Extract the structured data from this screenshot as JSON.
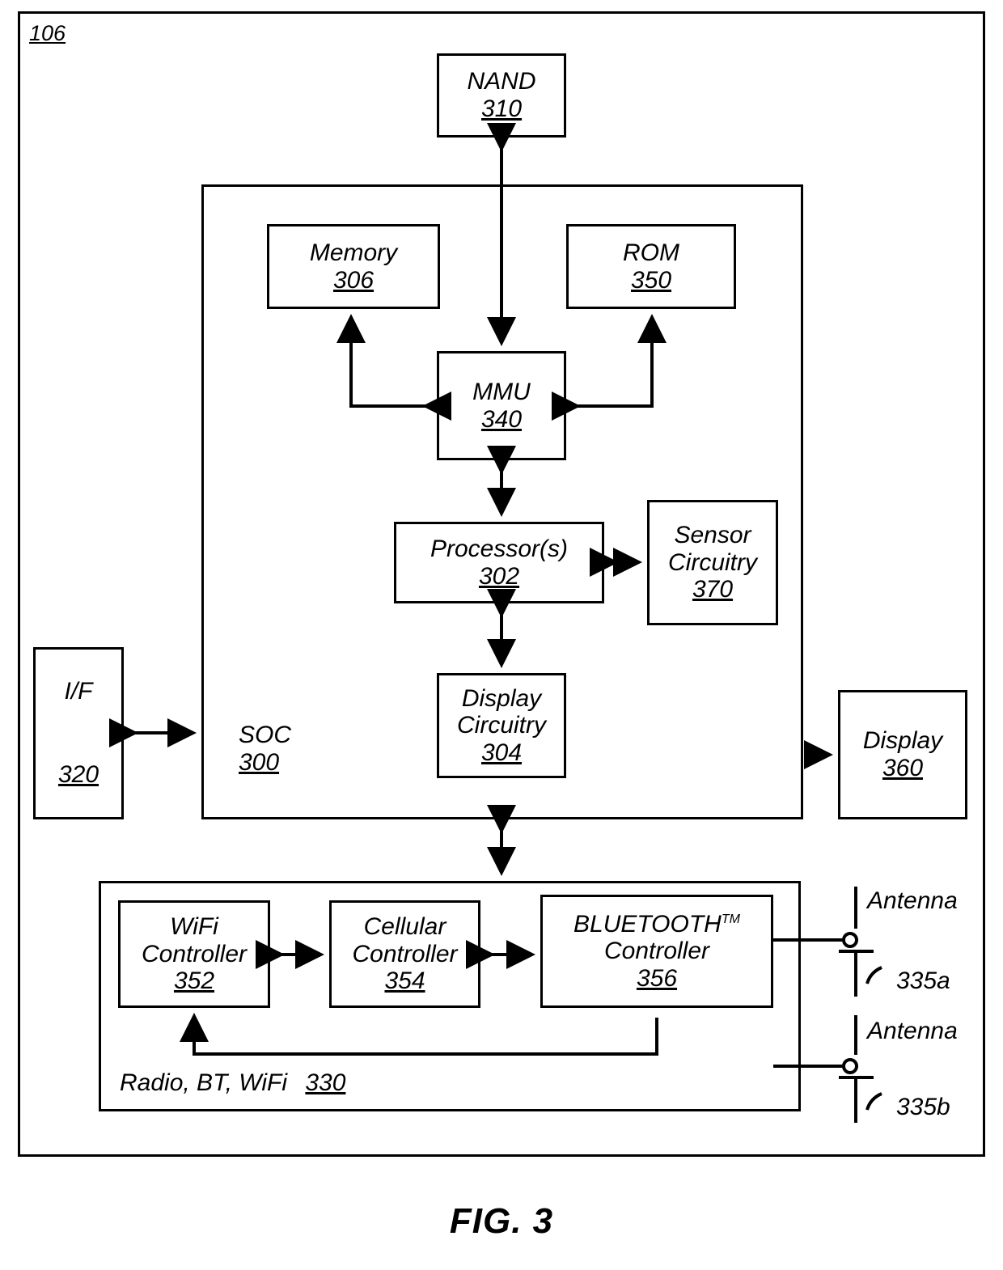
{
  "figure": {
    "caption": "FIG. 3",
    "outer_ref": "106"
  },
  "blocks": {
    "nand": {
      "label": "NAND",
      "num": "310"
    },
    "memory": {
      "label": "Memory",
      "num": "306"
    },
    "rom": {
      "label": "ROM",
      "num": "350"
    },
    "mmu": {
      "label": "MMU",
      "num": "340"
    },
    "processor": {
      "label": "Processor(s)",
      "num": "302"
    },
    "sensor": {
      "label_line1": "Sensor",
      "label_line2": "Circuitry",
      "num": "370"
    },
    "display_circuitry": {
      "label_line1": "Display",
      "label_line2": "Circuitry",
      "num": "304"
    },
    "display": {
      "label": "Display",
      "num": "360"
    },
    "interface": {
      "label": "I/F",
      "num": "320"
    },
    "soc": {
      "label": "SOC",
      "num": "300"
    },
    "radio": {
      "label": "Radio, BT, WiFi",
      "num": "330"
    },
    "wifi_controller": {
      "label_line1": "WiFi",
      "label_line2": "Controller",
      "num": "352"
    },
    "cellular_controller": {
      "label_line1": "Cellular",
      "label_line2": "Controller",
      "num": "354"
    },
    "bluetooth_controller": {
      "label_line1": "BLUETOOTH",
      "trademark": "TM",
      "label_line2": "Controller",
      "num": "356"
    }
  },
  "antennas": [
    {
      "label": "Antenna",
      "num": "335a"
    },
    {
      "label": "Antenna",
      "num": "335b"
    }
  ]
}
